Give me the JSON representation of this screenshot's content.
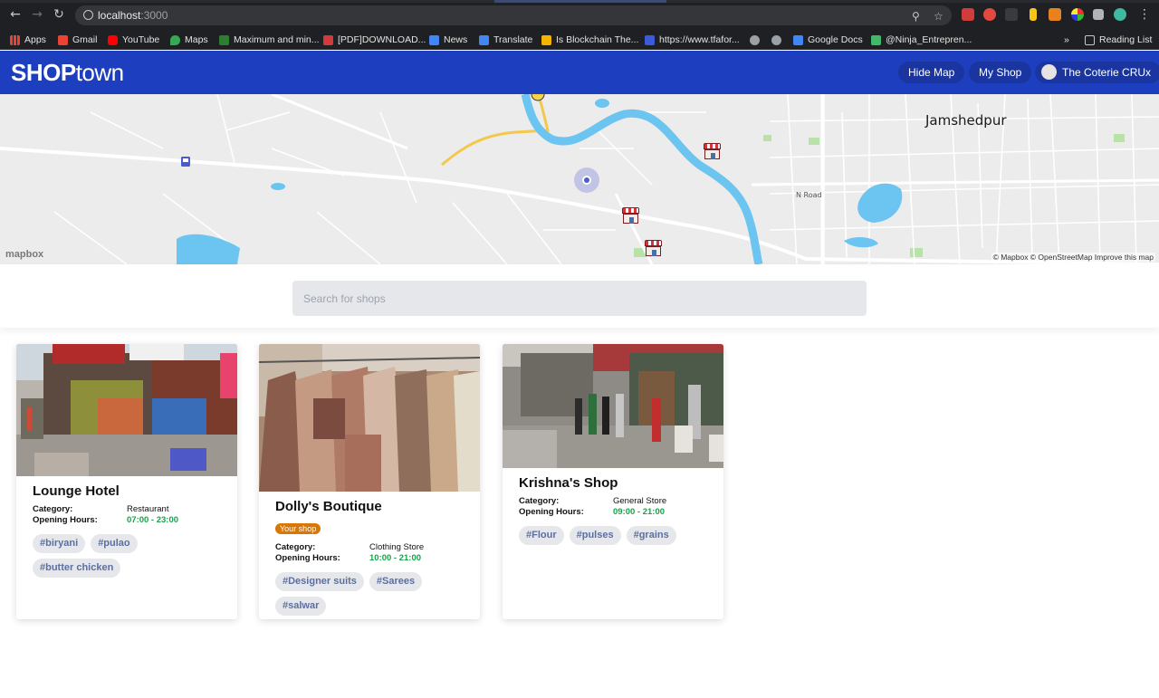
{
  "browser": {
    "url_host": "localhost",
    "url_port": ":3000",
    "bookmarks": [
      "Apps",
      "Gmail",
      "YouTube",
      "Maps",
      "Maximum and min...",
      "[PDF]DOWNLOAD...",
      "News",
      "Translate",
      "Is Blockchain The...",
      "https://www.tfafor...",
      "Google Docs",
      "@Ninja_Entrepren..."
    ],
    "bookmarks_overflow": "»",
    "reading_list": "Reading List"
  },
  "header": {
    "logo_bold": "SHOP",
    "logo_light": "town",
    "hide_map": "Hide Map",
    "my_shop": "My Shop",
    "user": "The Coterie CRUx"
  },
  "map": {
    "city": "Jamshedpur",
    "road": "N Road",
    "attribution": "© Mapbox © OpenStreetMap Improve this map",
    "logo": "mapbox"
  },
  "search": {
    "placeholder": "Search for shops"
  },
  "labels": {
    "category": "Category:",
    "hours": "Opening Hours:"
  },
  "shops": [
    {
      "name": "Lounge Hotel",
      "category": "Restaurant",
      "hours": "07:00 - 23:00",
      "tags": [
        "#biryani",
        "#pulao",
        "#butter chicken"
      ],
      "owned": false
    },
    {
      "name": "Dolly's Boutique",
      "badge": "Your shop",
      "category": "Clothing Store",
      "hours": "10:00 - 21:00",
      "tags": [
        "#Designer suits",
        "#Sarees",
        "#salwar"
      ],
      "owned": true
    },
    {
      "name": "Krishna's Shop",
      "category": "General Store",
      "hours": "09:00 - 21:00",
      "tags": [
        "#Flour",
        "#pulses",
        "#grains"
      ],
      "owned": false
    }
  ],
  "colors": {
    "header_blue": "#1d3fbf",
    "hours_green": "#16a34a",
    "badge_orange": "#d97706",
    "water": "#6cc4f0",
    "road_yellow": "#f2c94c"
  }
}
